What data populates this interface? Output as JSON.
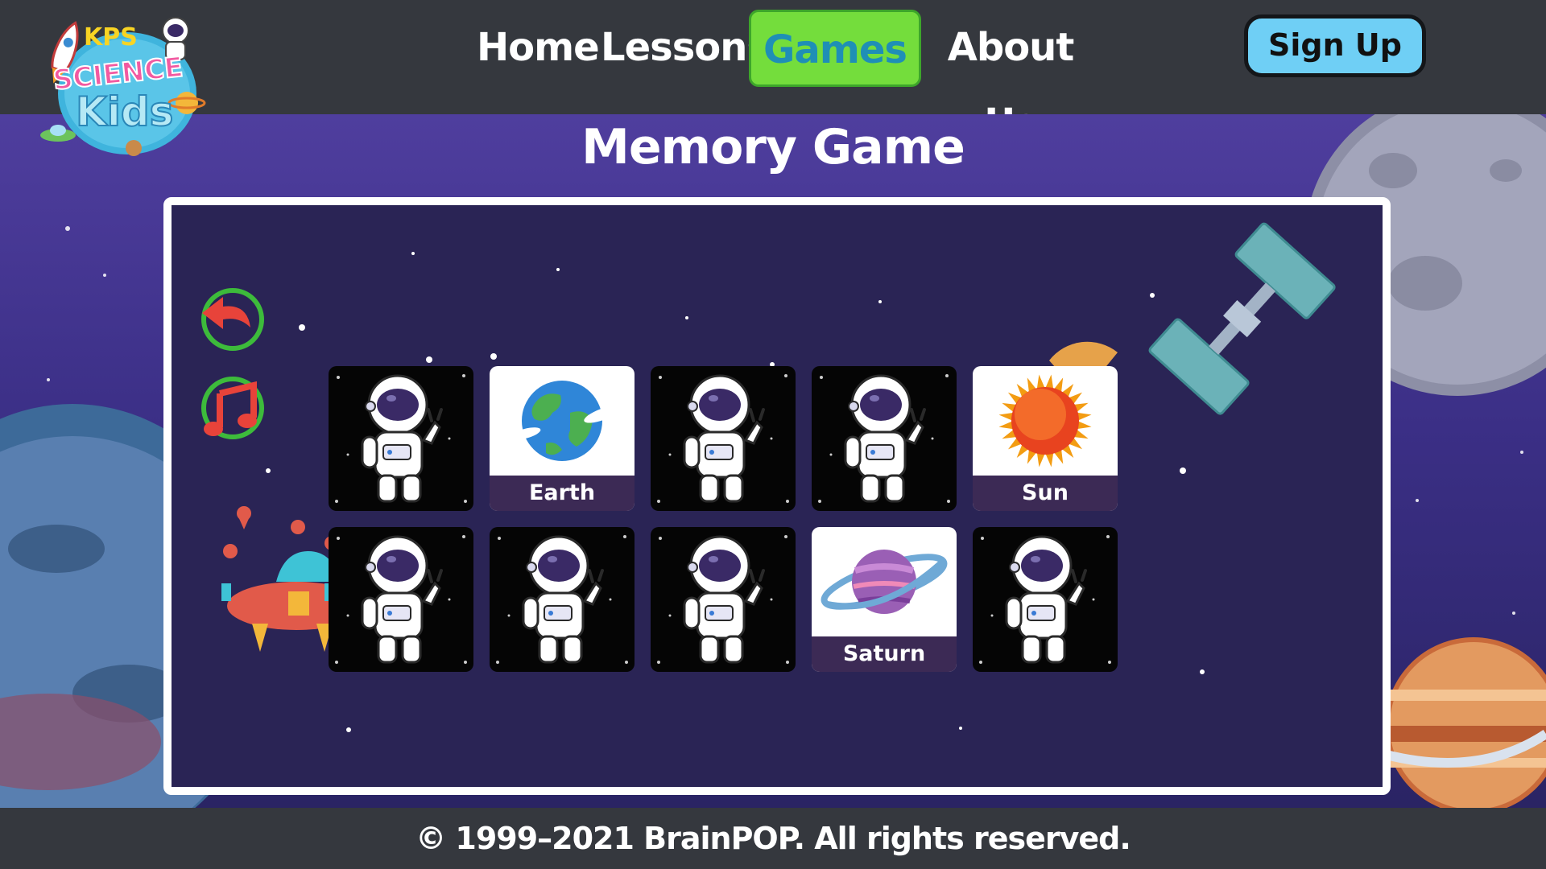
{
  "header": {
    "logo_text": [
      "KPS",
      "SCIENCE",
      "Kids"
    ],
    "nav": [
      {
        "label": "Home"
      },
      {
        "label": "Lessons"
      },
      {
        "label": "Games",
        "active": true
      },
      {
        "label": "About Us"
      }
    ],
    "signup_label": "Sign Up"
  },
  "page": {
    "title": "Memory Game"
  },
  "controls": {
    "back_icon": "undo-arrow-icon",
    "music_icon": "music-note-icon"
  },
  "game": {
    "rows": [
      [
        {
          "state": "hidden",
          "icon": "astronaut-icon"
        },
        {
          "state": "revealed",
          "icon": "earth-icon",
          "label": "Earth"
        },
        {
          "state": "hidden",
          "icon": "astronaut-icon"
        },
        {
          "state": "hidden",
          "icon": "astronaut-icon"
        },
        {
          "state": "revealed",
          "icon": "sun-icon",
          "label": "Sun"
        }
      ],
      [
        {
          "state": "hidden",
          "icon": "astronaut-icon"
        },
        {
          "state": "hidden",
          "icon": "astronaut-icon"
        },
        {
          "state": "hidden",
          "icon": "astronaut-icon"
        },
        {
          "state": "revealed",
          "icon": "saturn-icon",
          "label": "Saturn"
        },
        {
          "state": "hidden",
          "icon": "astronaut-icon"
        }
      ]
    ]
  },
  "footer": {
    "copyright": "© 1999–2021 BrainPOP. All rights reserved."
  },
  "colors": {
    "header_bg": "#35383e",
    "nav_active_bg": "#74dd3c",
    "nav_active_text": "#1f8fb6",
    "signup_bg": "#6fcff5",
    "board_bg": "#2a2455",
    "card_label_bg": "#3c2a55"
  }
}
